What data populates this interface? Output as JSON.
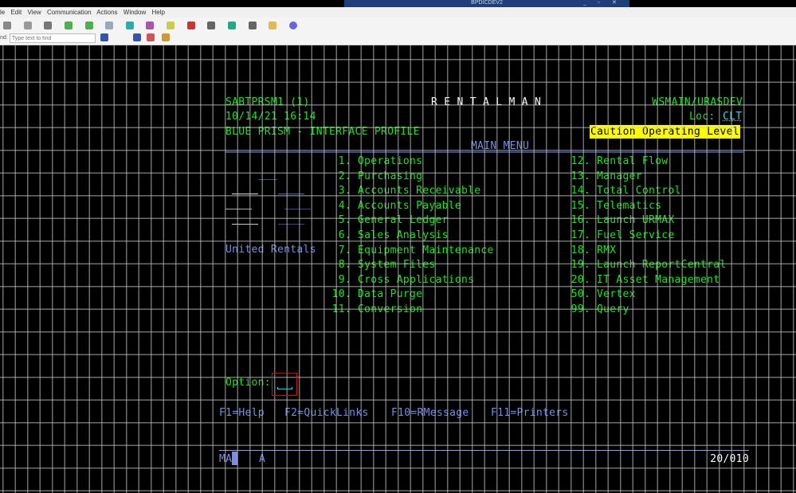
{
  "window": {
    "title": "BPDICDEV2",
    "min": "_",
    "restore": "▫",
    "close": "✕"
  },
  "menu": [
    "le",
    "Edit",
    "View",
    "Communication",
    "Actions",
    "Window",
    "Help"
  ],
  "find": {
    "label": "nd:",
    "placeholder": "Type text to find"
  },
  "screen": {
    "session": "SABTPRSM1 (1)",
    "app": "R E N T A L M A N",
    "user": "WSMAIN/URASDEV",
    "datetime": "10/14/21 16:14",
    "loc_label": "Loc:",
    "loc": "CLT",
    "profile": "BLUE PRISM - INTERFACE PROFILE",
    "caution": "Caution Operating Level",
    "menu_title": "MAIN MENU",
    "company": "United Rentals",
    "left_items": [
      [
        "1.",
        "Operations"
      ],
      [
        "2.",
        "Purchasing"
      ],
      [
        "3.",
        "Accounts Receivable"
      ],
      [
        "4.",
        "Accounts Payable"
      ],
      [
        "5.",
        "General Ledger"
      ],
      [
        "6.",
        "Sales Analysis"
      ],
      [
        "7.",
        "Equipment Maintenance"
      ],
      [
        "8.",
        "System Files"
      ],
      [
        "9.",
        "Cross Applications"
      ],
      [
        "10.",
        "Data Purge"
      ],
      [
        "11.",
        "Conversion"
      ]
    ],
    "right_items": [
      [
        "12.",
        "Rental Flow"
      ],
      [
        "13.",
        "Manager"
      ],
      [
        "14.",
        "Total Control"
      ],
      [
        "15.",
        "Telematics"
      ],
      [
        "16.",
        "Launch URMAX"
      ],
      [
        "17.",
        "Fuel Service"
      ],
      [
        "18.",
        "RMX"
      ],
      [
        "19.",
        "Launch ReportCentral"
      ],
      [
        "20.",
        "IT Asset Management"
      ],
      [
        "50.",
        "Vertex"
      ],
      [
        "99.",
        "Query"
      ]
    ],
    "option_label": "Option:",
    "option_value": "",
    "fkeys": [
      "F1=Help",
      "F2=QuickLinks",
      "F10=RMessage",
      "F11=Printers"
    ],
    "status": {
      "mode": "MA",
      "indicator": "A",
      "cursor": "20/010"
    }
  },
  "colors": {
    "green": "#19e619",
    "blue": "#7a8ce6",
    "caution_bg": "#ffff00"
  }
}
